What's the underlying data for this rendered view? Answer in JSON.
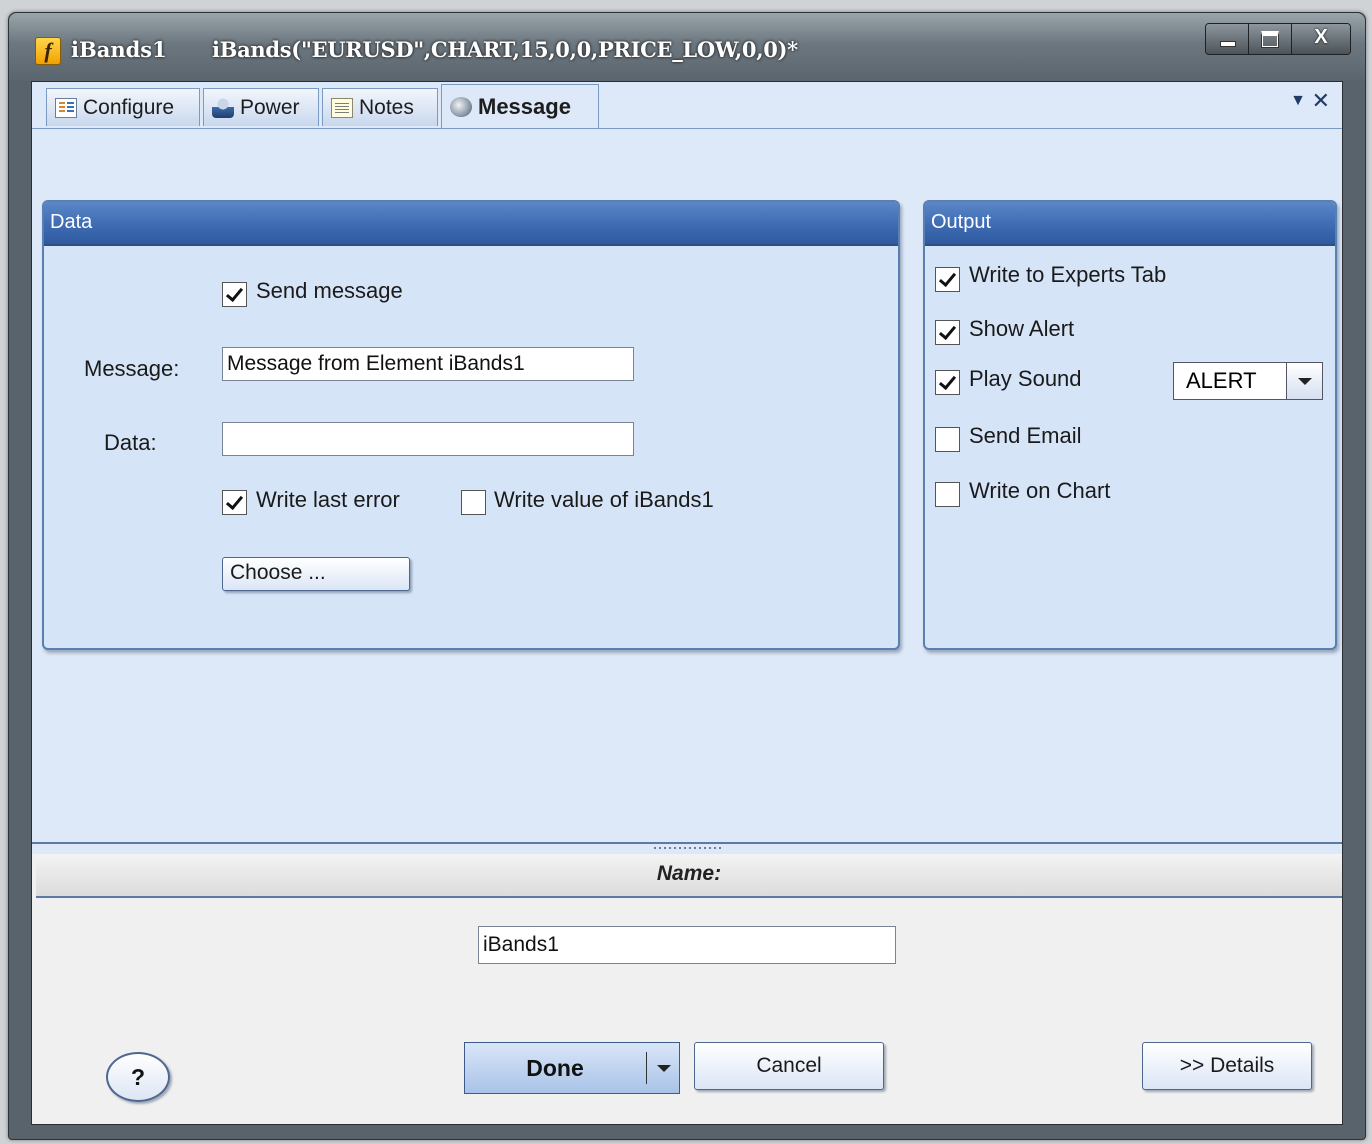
{
  "window": {
    "name": "iBands1",
    "formula": "iBands(\"EURUSD\",CHART,15,0,0,PRICE_LOW,0,0)*",
    "caption_close": "X"
  },
  "tabs": [
    {
      "label": "Configure",
      "icon": "configure-icon"
    },
    {
      "label": "Power",
      "icon": "power-icon"
    },
    {
      "label": "Notes",
      "icon": "notes-icon"
    },
    {
      "label": "Message",
      "icon": "message-icon",
      "active": true
    }
  ],
  "tab_controls": {
    "dropdown": "▼",
    "close": "✕"
  },
  "data_panel": {
    "title": "Data",
    "send_message": {
      "label": "Send message",
      "checked": true
    },
    "message": {
      "label": "Message:",
      "value": "Message from Element iBands1"
    },
    "data": {
      "label": "Data:",
      "value": ""
    },
    "write_last_error": {
      "label": "Write last error",
      "checked": true
    },
    "write_value": {
      "label": "Write value of iBands1",
      "checked": false
    },
    "choose_label": "Choose ..."
  },
  "output_panel": {
    "title": "Output",
    "write_experts": {
      "label": "Write to Experts Tab",
      "checked": true
    },
    "show_alert": {
      "label": "Show Alert",
      "checked": true
    },
    "play_sound": {
      "label": "Play Sound",
      "checked": true
    },
    "sound_select": "ALERT",
    "send_email": {
      "label": "Send Email",
      "checked": false
    },
    "write_chart": {
      "label": "Write on Chart",
      "checked": false
    }
  },
  "bottom": {
    "name_label": "Name:",
    "name_value": "iBands1",
    "help_label": "?",
    "done_label": "Done",
    "cancel_label": "Cancel",
    "details_label": ">> Details"
  },
  "colors": {
    "panel_header": "#3e6bb3",
    "panel_bg": "#d6e4f8",
    "client_bg": "#dde8f8"
  }
}
